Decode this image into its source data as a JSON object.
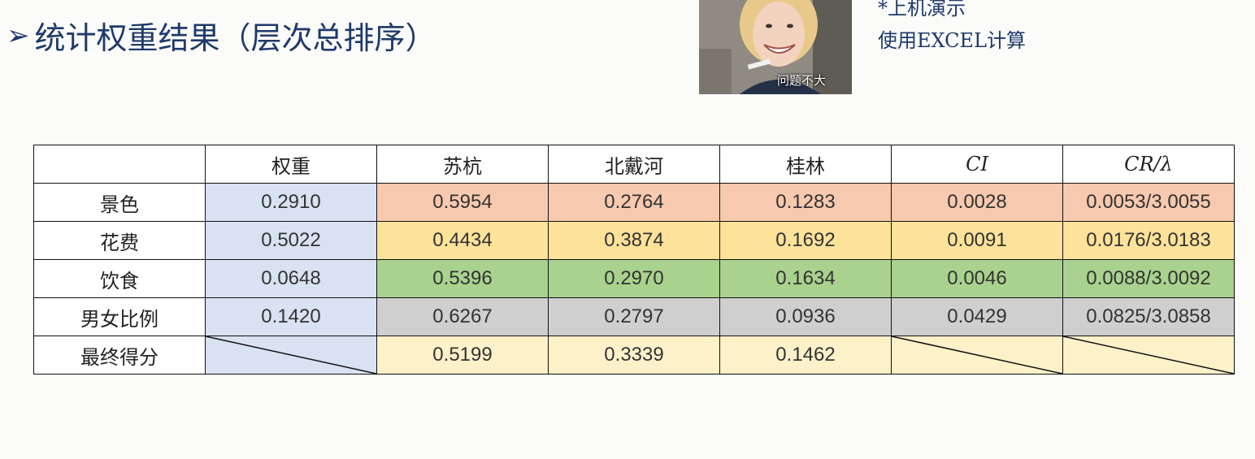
{
  "slide": {
    "title_marker": "➢",
    "title": "统计权重结果（层次总排序）",
    "note_line1": "*上机演示",
    "note_line2": "使用EXCEL计算",
    "photo_caption": "问题不大"
  },
  "table": {
    "headers": [
      "",
      "权重",
      "苏杭",
      "北戴河",
      "桂林",
      "CI",
      "CR/λ"
    ],
    "rows": [
      {
        "label": "景色",
        "cells": [
          "0.2910",
          "0.5954",
          "0.2764",
          "0.1283",
          "0.0028",
          "0.0053/3.0055"
        ],
        "color": "#f7c9ae"
      },
      {
        "label": "花费",
        "cells": [
          "0.5022",
          "0.4434",
          "0.3874",
          "0.1692",
          "0.0091",
          "0.0176/3.0183"
        ],
        "color": "#fde29a"
      },
      {
        "label": "饮食",
        "cells": [
          "0.0648",
          "0.5396",
          "0.2970",
          "0.1634",
          "0.0046",
          "0.0088/3.0092"
        ],
        "color": "#a9d28e"
      },
      {
        "label": "男女比例",
        "cells": [
          "0.1420",
          "0.6267",
          "0.2797",
          "0.0936",
          "0.0429",
          "0.0825/3.0858"
        ],
        "color": "#cfcfcf"
      },
      {
        "label": "最终得分",
        "cells": [
          "",
          "0.5199",
          "0.3339",
          "0.1462",
          "",
          ""
        ],
        "color": "#fdf1c9"
      }
    ],
    "weight_column_color": "#d9e2f2"
  }
}
